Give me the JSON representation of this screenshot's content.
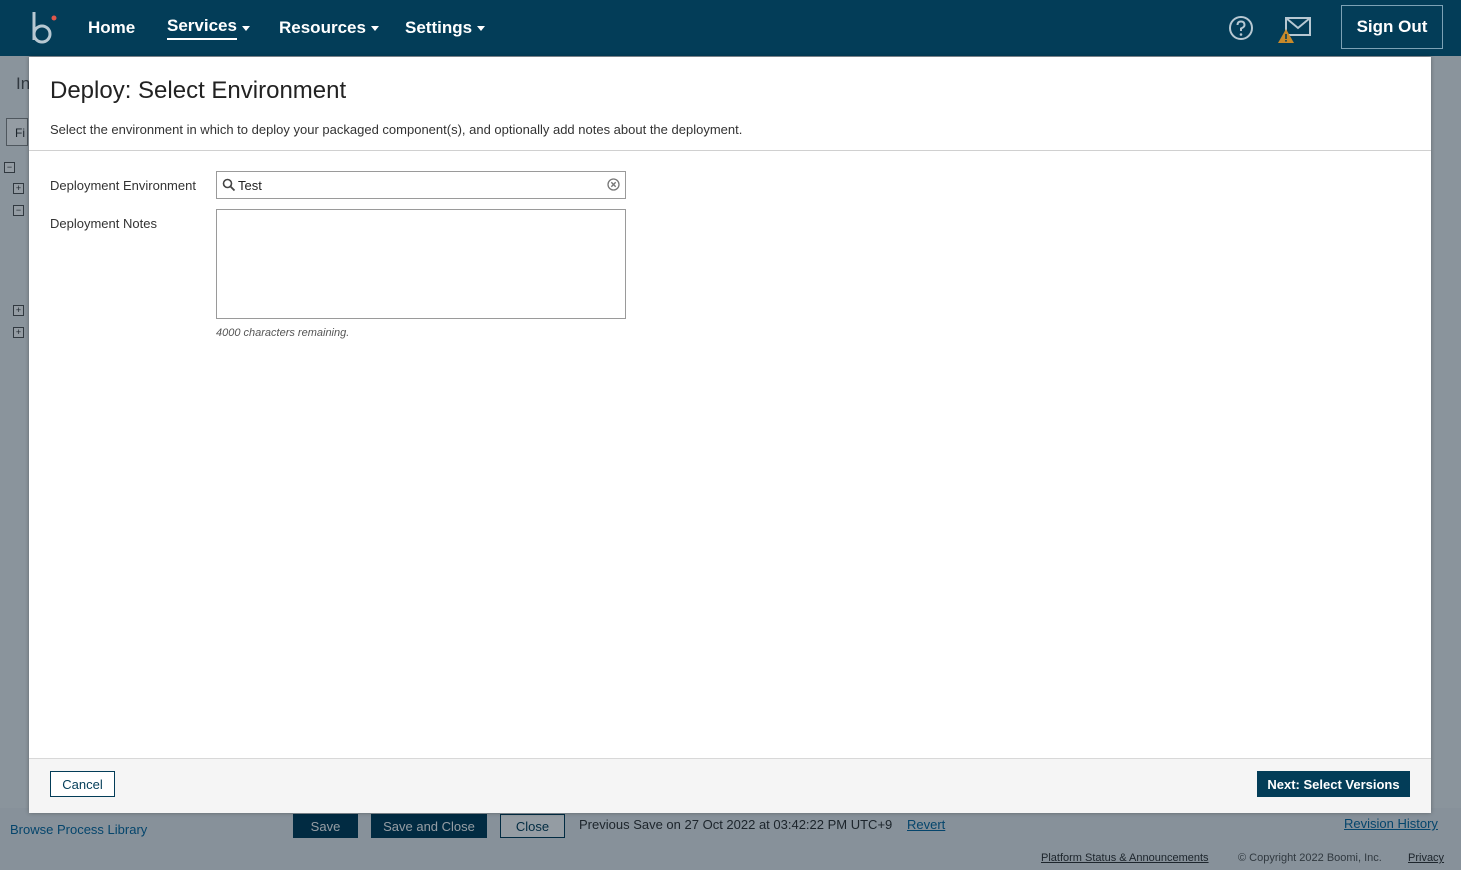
{
  "header": {
    "nav": [
      {
        "label": "Home"
      },
      {
        "label": "Services"
      },
      {
        "label": "Resources"
      },
      {
        "label": "Settings"
      }
    ],
    "sign_out_label": "Sign Out"
  },
  "background": {
    "page_title_fragment": "In",
    "filter_fragment": "Fi",
    "browse_library": "Browse Process Library",
    "save_label": "Save",
    "save_close_label": "Save and Close",
    "close_label": "Close",
    "previous_save": "Previous Save on 27 Oct 2022 at 03:42:22 PM UTC+9",
    "revert_label": "Revert",
    "revision_history": "Revision History",
    "footer": {
      "platform_status": "Platform Status & Announcements",
      "copyright": "© Copyright 2022 Boomi, Inc.",
      "privacy": "Privacy"
    }
  },
  "modal": {
    "title": "Deploy: Select Environment",
    "description": "Select the environment in which to deploy your packaged component(s), and optionally add notes about the deployment.",
    "environment_label": "Deployment Environment",
    "environment_value": "Test",
    "notes_label": "Deployment Notes",
    "notes_value": "",
    "chars_remaining": "4000 characters remaining.",
    "cancel_label": "Cancel",
    "next_label": "Next: Select Versions"
  },
  "colors": {
    "brand_dark": "#033d58",
    "link": "#0a6aa1"
  }
}
